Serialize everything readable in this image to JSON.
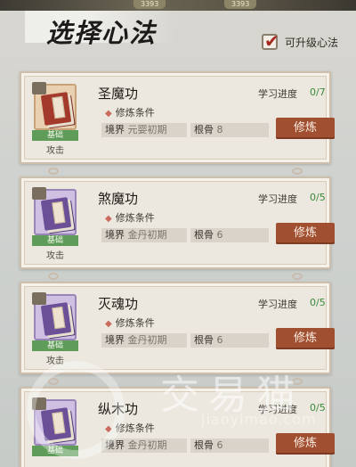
{
  "topbar": {
    "pill_left": "3393",
    "pill_right": "3393"
  },
  "header": {
    "title": "选择心法",
    "filter_label": "可升级心法"
  },
  "skills": [
    {
      "name": "圣魔功",
      "progress_label": "学习进度",
      "progress": "0/7",
      "condition_label": "修炼条件",
      "realm_label": "境界",
      "realm": "元婴初期",
      "bone_label": "根骨",
      "bone": "8",
      "tag": "基础",
      "subtag": "攻击",
      "button": "修炼"
    },
    {
      "name": "煞魔功",
      "progress_label": "学习进度",
      "progress": "0/5",
      "condition_label": "修炼条件",
      "realm_label": "境界",
      "realm": "金丹初期",
      "bone_label": "根骨",
      "bone": "6",
      "tag": "基础",
      "subtag": "攻击",
      "button": "修炼"
    },
    {
      "name": "灭魂功",
      "progress_label": "学习进度",
      "progress": "0/5",
      "condition_label": "修炼条件",
      "realm_label": "境界",
      "realm": "金丹初期",
      "bone_label": "根骨",
      "bone": "6",
      "tag": "基础",
      "subtag": "攻击",
      "button": "修炼"
    },
    {
      "name": "纵木功",
      "progress_label": "学习进度",
      "progress": "0/5",
      "condition_label": "修炼条件",
      "realm_label": "境界",
      "realm": "金丹初期",
      "bone_label": "根骨",
      "bone": "6",
      "tag": "基础",
      "subtag": "",
      "button": "修炼"
    }
  ],
  "watermark": {
    "text": "交易猫",
    "url": "jiaoyimao.com"
  },
  "colors": {
    "accent_button": "#a14f31",
    "progress_green": "#3b8a3c",
    "tag_green": "#5f9c5a"
  }
}
